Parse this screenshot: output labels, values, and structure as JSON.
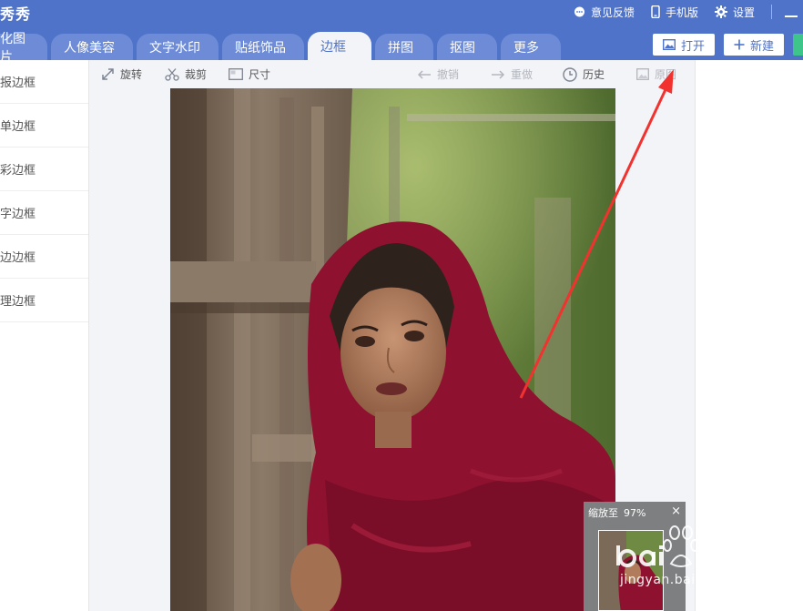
{
  "app": {
    "title": "秀秀"
  },
  "title_links": [
    {
      "name": "feedback",
      "label": "意见反馈",
      "icon": "chat-bubble-icon"
    },
    {
      "name": "mobile",
      "label": "手机版",
      "icon": "phone-icon"
    },
    {
      "name": "settings",
      "label": "设置",
      "icon": "gear-icon"
    }
  ],
  "tabs": [
    {
      "name": "beautify",
      "label": "化图片"
    },
    {
      "name": "portrait",
      "label": "人像美容"
    },
    {
      "name": "text",
      "label": "文字水印"
    },
    {
      "name": "sticker",
      "label": "贴纸饰品"
    },
    {
      "name": "border",
      "label": "边框",
      "active": true
    },
    {
      "name": "collage",
      "label": "拼图"
    },
    {
      "name": "cutout",
      "label": "抠图"
    },
    {
      "name": "more",
      "label": "更多"
    }
  ],
  "actions": {
    "open": "打开",
    "new": "新建"
  },
  "sidebar": {
    "items": [
      {
        "label": "报边框"
      },
      {
        "label": "单边框"
      },
      {
        "label": "彩边框"
      },
      {
        "label": "字边框"
      },
      {
        "label": "边边框"
      },
      {
        "label": "理边框"
      }
    ]
  },
  "toolbar": {
    "rotate": "旋转",
    "crop": "裁剪",
    "size": "尺寸",
    "undo": "撤销",
    "redo": "重做",
    "history": "历史",
    "original": "原图"
  },
  "zoom": {
    "label": "缩放至",
    "value": "97%",
    "close": "×"
  },
  "watermark": {
    "site": "jingyan.baidu.com"
  },
  "colors": {
    "brand": "#4f73c9",
    "tab": "#6d8bd6",
    "active_bg": "#f3f4f8",
    "arrow": "#f2322f",
    "green": "#3ec58a"
  }
}
